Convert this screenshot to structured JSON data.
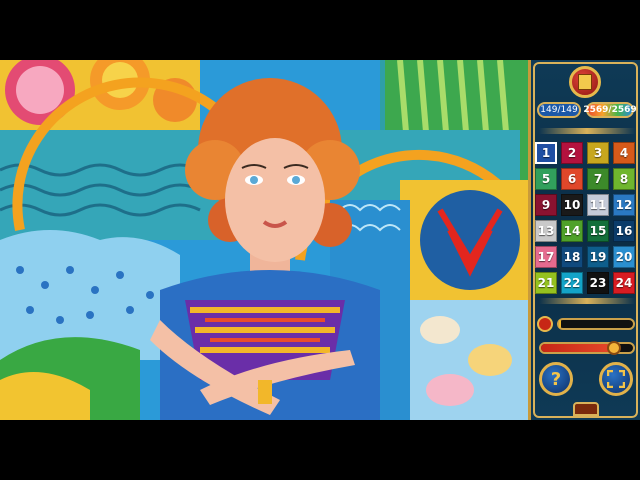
{
  "counters": {
    "progress": "149/149",
    "score": "2569/2569"
  },
  "palette": [
    {
      "label": "1",
      "color": "#1f4fa3",
      "selected": true
    },
    {
      "label": "2",
      "color": "#b3123e"
    },
    {
      "label": "3",
      "color": "#c7a71e"
    },
    {
      "label": "4",
      "color": "#d65a1a"
    },
    {
      "label": "5",
      "color": "#31a05c"
    },
    {
      "label": "6",
      "color": "#e0472a"
    },
    {
      "label": "7",
      "color": "#3c8a2a"
    },
    {
      "label": "8",
      "color": "#6fb62e"
    },
    {
      "label": "9",
      "color": "#8a1230"
    },
    {
      "label": "10",
      "color": "#1a1a1a"
    },
    {
      "label": "11",
      "color": "#c5cbd8"
    },
    {
      "label": "12",
      "color": "#2a79c2"
    },
    {
      "label": "13",
      "color": "#c9c9c9"
    },
    {
      "label": "14",
      "color": "#4fa12a"
    },
    {
      "label": "15",
      "color": "#136f3a"
    },
    {
      "label": "16",
      "color": "#0b3c6a"
    },
    {
      "label": "17",
      "color": "#e56a8f"
    },
    {
      "label": "18",
      "color": "#104a7e"
    },
    {
      "label": "19",
      "color": "#0e5e8c"
    },
    {
      "label": "20",
      "color": "#2a8fd0"
    },
    {
      "label": "21",
      "color": "#95c21f"
    },
    {
      "label": "22",
      "color": "#13a4c8"
    },
    {
      "label": "23",
      "color": "#111111"
    },
    {
      "label": "24",
      "color": "#d81c23"
    }
  ],
  "zoom_level": 0.03,
  "hint_level": 0.78,
  "buttons": {
    "help_label": "?"
  },
  "colors": {
    "panel_bg": "#0f3a56",
    "gold_trim": "#d9b25a"
  }
}
